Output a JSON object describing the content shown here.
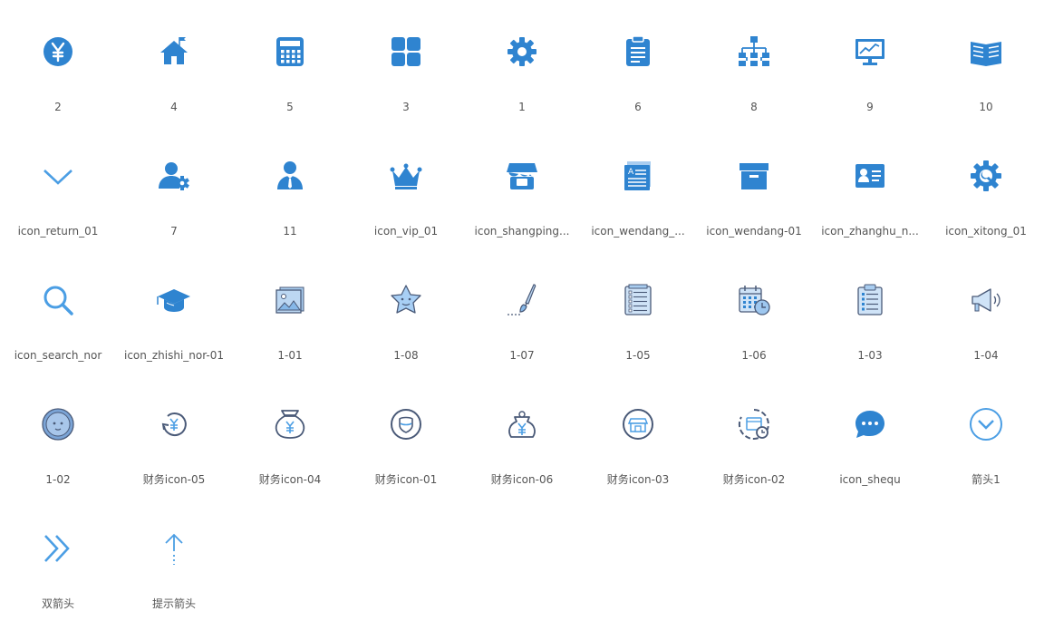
{
  "colors": {
    "primary": "#2f84d0",
    "light": "#4b9ee4",
    "pale": "#a9cdf0",
    "navy": "#4a5a78",
    "label": "#555555"
  },
  "icons": [
    {
      "label": "2",
      "icon": "yen-circle-icon"
    },
    {
      "label": "4",
      "icon": "home-icon"
    },
    {
      "label": "5",
      "icon": "calculator-icon"
    },
    {
      "label": "3",
      "icon": "grid-icon"
    },
    {
      "label": "1",
      "icon": "gear-icon"
    },
    {
      "label": "6",
      "icon": "clipboard-icon"
    },
    {
      "label": "8",
      "icon": "org-chart-icon"
    },
    {
      "label": "9",
      "icon": "monitor-chart-icon"
    },
    {
      "label": "10",
      "icon": "book-icon"
    },
    {
      "label": "icon_return_01",
      "icon": "chevron-down-icon"
    },
    {
      "label": "7",
      "icon": "user-gear-icon"
    },
    {
      "label": "11",
      "icon": "businessman-icon"
    },
    {
      "label": "icon_vip_01",
      "icon": "crown-icon"
    },
    {
      "label": "icon_shangping...",
      "icon": "shop-icon"
    },
    {
      "label": "icon_wendang_...",
      "icon": "document-stack-icon"
    },
    {
      "label": "icon_wendang-01",
      "icon": "archive-box-icon"
    },
    {
      "label": "icon_zhanghu_n...",
      "icon": "id-card-icon"
    },
    {
      "label": "icon_xitong_01",
      "icon": "gear-wrench-icon"
    },
    {
      "label": "icon_search_nor",
      "icon": "search-icon"
    },
    {
      "label": "icon_zhishi_nor-01",
      "icon": "graduation-cap-icon"
    },
    {
      "label": "1-01",
      "icon": "photo-album-icon"
    },
    {
      "label": "1-08",
      "icon": "star-face-icon"
    },
    {
      "label": "1-07",
      "icon": "paintbrush-icon"
    },
    {
      "label": "1-05",
      "icon": "notebook-list-icon"
    },
    {
      "label": "1-06",
      "icon": "calendar-clock-icon"
    },
    {
      "label": "1-03",
      "icon": "clipboard-list-icon"
    },
    {
      "label": "1-04",
      "icon": "megaphone-icon"
    },
    {
      "label": "1-02",
      "icon": "face-circle-icon"
    },
    {
      "label": "财务icon-05",
      "icon": "yen-refresh-icon"
    },
    {
      "label": "财务icon-04",
      "icon": "money-bag-icon"
    },
    {
      "label": "财务icon-01",
      "icon": "shield-circle-icon"
    },
    {
      "label": "财务icon-06",
      "icon": "yen-bag-icon"
    },
    {
      "label": "财务icon-03",
      "icon": "shop-circle-icon"
    },
    {
      "label": "财务icon-02",
      "icon": "calendar-clock-circle-icon"
    },
    {
      "label": "icon_shequ",
      "icon": "chat-bubble-icon"
    },
    {
      "label": "箭头1",
      "icon": "chevron-circle-icon"
    },
    {
      "label": "双箭头",
      "icon": "double-chevron-right-icon"
    },
    {
      "label": "提示箭头",
      "icon": "arrow-up-icon"
    }
  ]
}
